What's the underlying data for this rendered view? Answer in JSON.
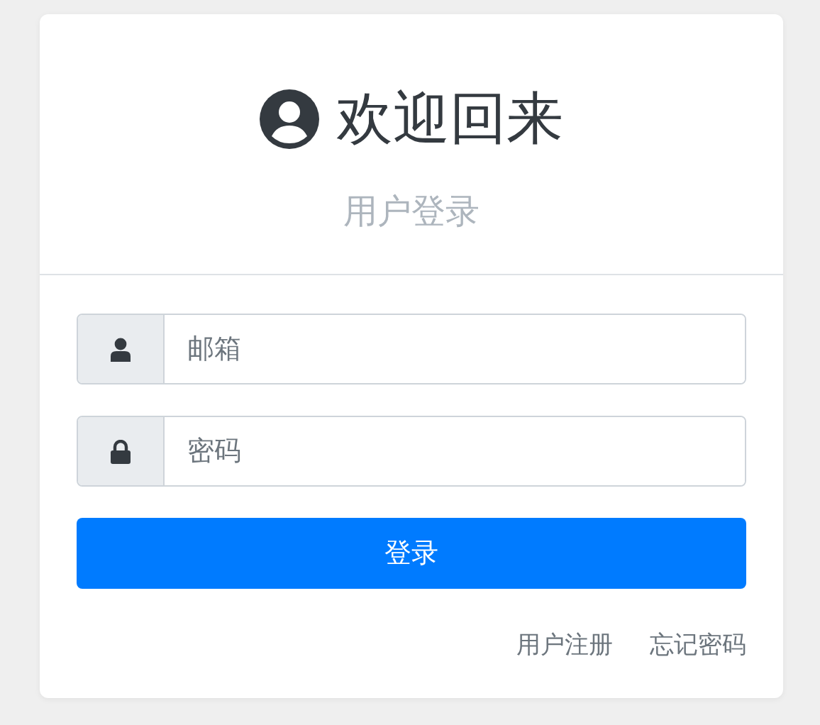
{
  "header": {
    "title": "欢迎回来",
    "subtitle": "用户登录"
  },
  "fields": [
    {
      "kind": "user",
      "placeholder": "邮箱"
    },
    {
      "kind": "lock",
      "placeholder": "密码"
    }
  ],
  "submit": "登录",
  "links": [
    "用户注册",
    "忘记密码"
  ]
}
